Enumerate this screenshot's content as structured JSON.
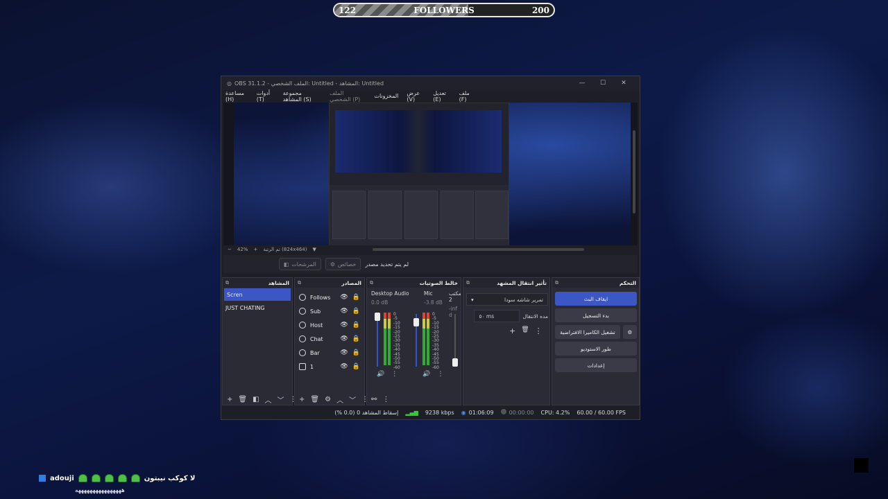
{
  "followers_bar": {
    "current": "122",
    "label": "FOLLOWERS",
    "goal": "200",
    "progress": 0.61
  },
  "window": {
    "title": "OBS 31.1.2 - الملف الشخصي: Untitled - المشاهد: Untitled",
    "buttons": [
      "—",
      "☐",
      "✕"
    ],
    "menu": [
      "ملف (F)",
      "تعديل (E)",
      "عرض (V)",
      "المخزونات",
      "الملف الشخصي (P)",
      "مجموعة المشاهد (S)",
      "أدوات (T)",
      "مساعدة (H)"
    ]
  },
  "preview": {
    "zoom": "42%",
    "resolution": "تم الرتبة (824x464)"
  },
  "toolbar": {
    "no_source": "لم يتم تحديد مصدر",
    "properties": "خصائص",
    "filters": "المرشحات"
  },
  "docks": {
    "scenes": {
      "title": "المشاهد",
      "items": [
        "Scren",
        "JUST CHATING"
      ]
    },
    "sources": {
      "title": "المصادر",
      "items": [
        {
          "name": "Follows",
          "icon": "globe-icon"
        },
        {
          "name": "Sub",
          "icon": "globe-icon"
        },
        {
          "name": "Host",
          "icon": "globe-icon"
        },
        {
          "name": "Chat",
          "icon": "globe-icon"
        },
        {
          "name": "Bar",
          "icon": "globe-icon"
        },
        {
          "name": "1",
          "icon": "monitor-icon"
        }
      ]
    },
    "mixer": {
      "title": "خالط الصوتيات",
      "channels": [
        {
          "name": "Desktop Audio",
          "db": "0.0 dB"
        },
        {
          "name": "Mic",
          "db": "-3.8 dB"
        },
        {
          "name": "مكتب 2",
          "db": "-inf d"
        }
      ],
      "scale": [
        "0",
        "-5",
        "-10",
        "-15",
        "-20",
        "-25",
        "-30",
        "-35",
        "-40",
        "-45",
        "-50",
        "-55",
        "-60"
      ]
    },
    "transitions": {
      "title": "تأثير انتقال المشهد",
      "selected": "تمرير شاشه سودا",
      "duration_label": "مده الانتقال",
      "duration": "٥٠ ms"
    },
    "controls": {
      "title": "التحكم",
      "buttons": [
        "ايقاف البث",
        "بدء التسجيل",
        "تشغيل الكاميرا الافتراضية",
        "طور الاستوديو",
        "إعدادات"
      ]
    }
  },
  "status": {
    "dropped": "إسقاط المشاهد 0 (0.0 %)",
    "bitrate": "9238 kbps",
    "stream_time": "01:06:09",
    "rec_time": "00:00:00",
    "cpu": "CPU: 4.2%",
    "fps": "60.00 / 60.00 FPS"
  },
  "chat": {
    "user": "adouji",
    "message": "لا كوكب نيبتون",
    "line2": "ههههههههههههههههه"
  }
}
